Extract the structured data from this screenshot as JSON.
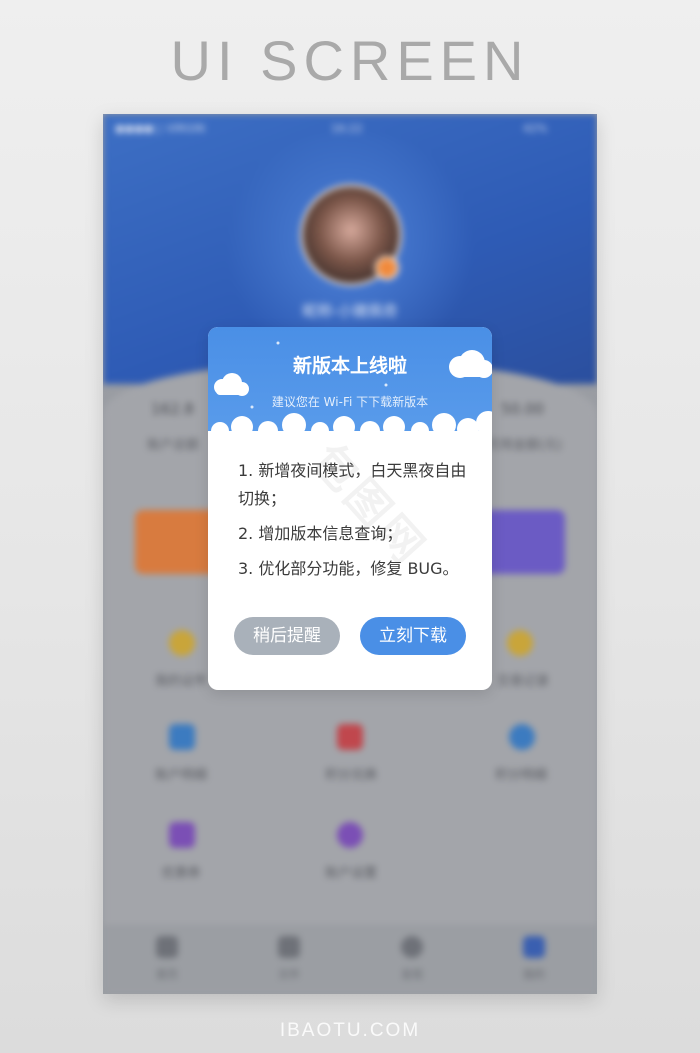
{
  "banner": {
    "title": "UI SCREEN",
    "site": "IBAOTU.COM"
  },
  "phone": {
    "status": {
      "carrier": "●●●●○ VIRGIN",
      "time": "16:22",
      "battery": "42%"
    },
    "nickname": "昵称-小猪佩奇",
    "stats": [
      {
        "value": "162.8",
        "label": "账户总额"
      },
      {
        "value": "50.00",
        "label": "可用金额(元)"
      }
    ],
    "grid": [
      {
        "label": "我的证件",
        "color": "#c9a53a"
      },
      {
        "label": "交易记录",
        "color": "#c9a53a"
      },
      {
        "label": "账户明细",
        "color": "#3c7bc0"
      },
      {
        "label": "积分兑换",
        "color": "#c0474d"
      },
      {
        "label": "积分明细",
        "color": "#3c7bc0"
      },
      {
        "label": "优惠券",
        "color": "#7b4fb5"
      },
      {
        "label": "账户设置",
        "color": "#7b4fb5"
      }
    ],
    "tabs": [
      {
        "label": "首页"
      },
      {
        "label": "文件"
      },
      {
        "label": "发现"
      },
      {
        "label": "我的"
      }
    ]
  },
  "dialog": {
    "title": "新版本上线啦",
    "subtitle": "建议您在 Wi-Fi 下下载新版本",
    "items": [
      "1. 新增夜间模式，白天黑夜自由切换；",
      "2. 增加版本信息查询；",
      "3. 优化部分功能，修复 BUG。"
    ],
    "later_label": "稍后提醒",
    "download_label": "立刻下载"
  },
  "colors": {
    "accent": "#4a8fe6",
    "later": "#a9b1ba"
  },
  "watermark": "包图网"
}
